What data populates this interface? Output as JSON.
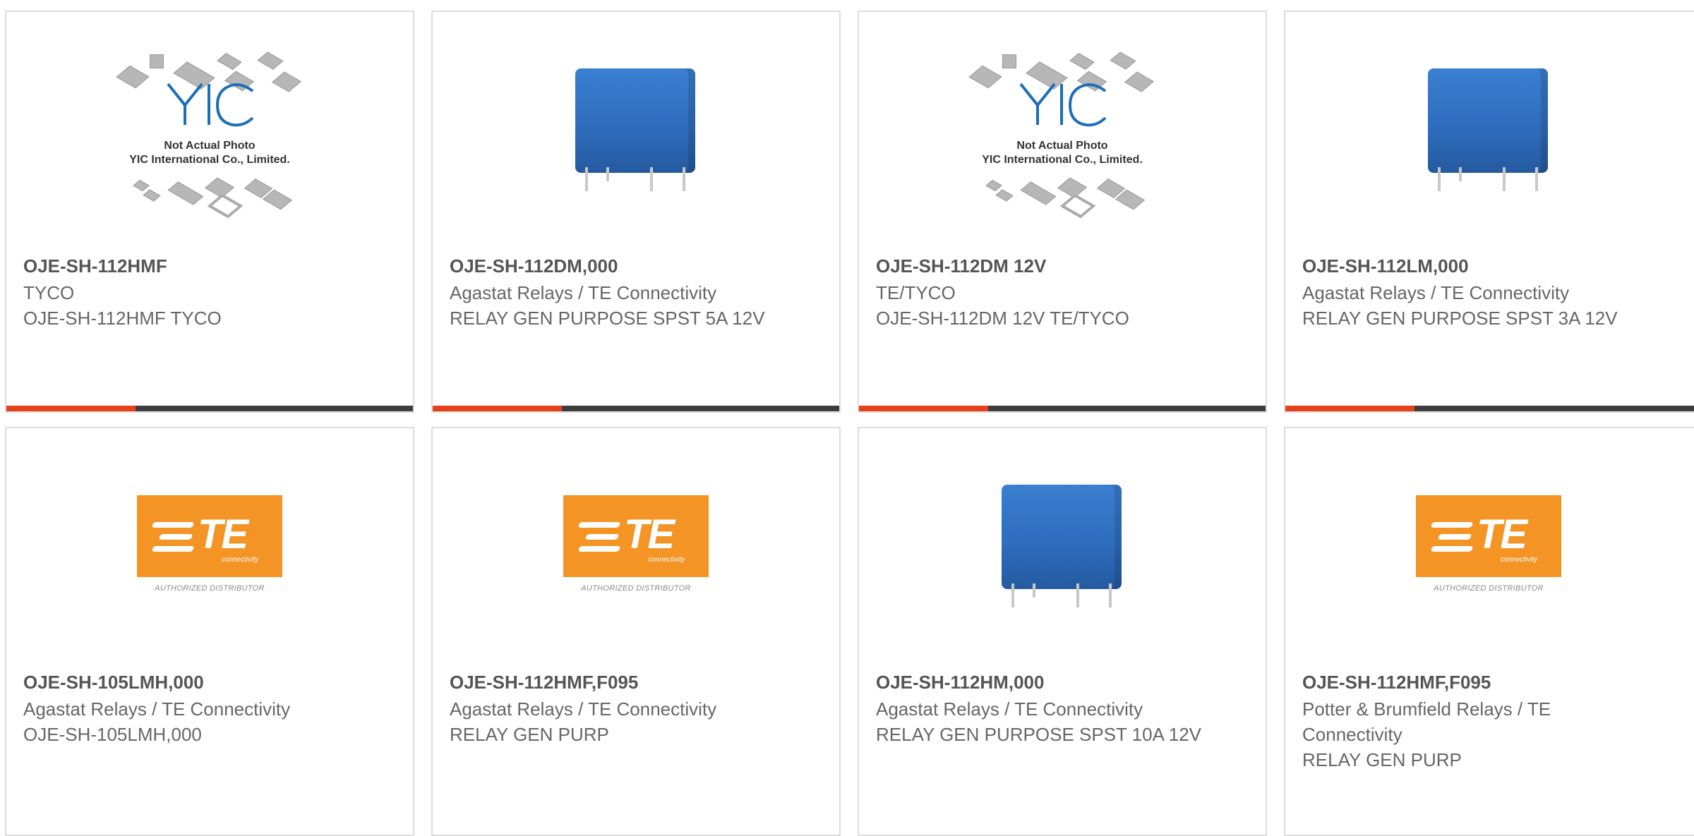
{
  "products": [
    {
      "part": "OJE-SH-112HMF",
      "manufacturer": "TYCO",
      "description": "OJE-SH-112HMF TYCO",
      "image": "yic-placeholder"
    },
    {
      "part": "OJE-SH-112DM,000",
      "manufacturer": "Agastat Relays / TE Connectivity",
      "description": "RELAY GEN PURPOSE SPST 5A 12V",
      "image": "relay-photo"
    },
    {
      "part": "OJE-SH-112DM 12V",
      "manufacturer": "TE/TYCO",
      "description": "OJE-SH-112DM 12V TE/TYCO",
      "image": "yic-placeholder"
    },
    {
      "part": "OJE-SH-112LM,000",
      "manufacturer": "Agastat Relays / TE Connectivity",
      "description": "RELAY GEN PURPOSE SPST 3A 12V",
      "image": "relay-photo"
    },
    {
      "part": "OJE-SH-105LMH,000",
      "manufacturer": "Agastat Relays / TE Connectivity",
      "description": "OJE-SH-105LMH,000",
      "image": "te-logo"
    },
    {
      "part": "OJE-SH-112HMF,F095",
      "manufacturer": "Agastat Relays / TE Connectivity",
      "description": "RELAY GEN PURP",
      "image": "te-logo"
    },
    {
      "part": "OJE-SH-112HM,000",
      "manufacturer": "Agastat Relays / TE Connectivity",
      "description": "RELAY GEN PURPOSE SPST 10A 12V",
      "image": "relay-photo"
    },
    {
      "part": "OJE-SH-112HMF,F095",
      "manufacturer": "Potter & Brumfield Relays / TE Connectivity",
      "description": "RELAY GEN PURP",
      "image": "te-logo"
    }
  ],
  "yic_placeholder": {
    "logo_text": "YIC",
    "line1": "Not Actual Photo",
    "line2": "YIC International Co., Limited."
  },
  "te_logo": {
    "mark": "TE",
    "sub": "connectivity",
    "distributor": "AUTHORIZED DISTRIBUTOR"
  },
  "colors": {
    "accent": "#e6411c",
    "bar": "#3d3d3d",
    "te_orange": "#f39425",
    "relay_blue": "#2f6dbd"
  }
}
